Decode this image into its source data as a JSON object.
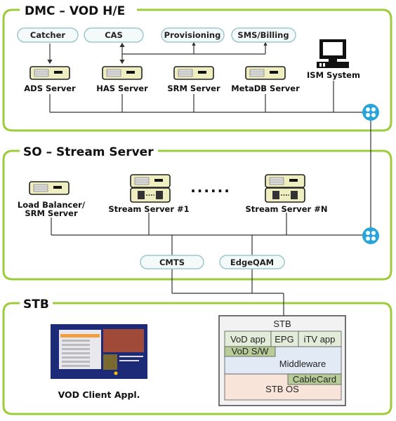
{
  "sections": {
    "dmc": {
      "title": "DMC – VOD H/E"
    },
    "so": {
      "title": "SO – Stream Server"
    },
    "stb": {
      "title": "STB"
    }
  },
  "dmc_pills": [
    "Catcher",
    "CAS",
    "Provisioning",
    "SMS/Billing"
  ],
  "dmc_servers": [
    "ADS Server",
    "HAS Server",
    "SRM Server",
    "MetaDB Server"
  ],
  "ism": "ISM System",
  "so_servers": {
    "lb_line1": "Load Balancer/",
    "lb_line2": "SRM Server",
    "ss1": "Stream Server #1",
    "ssn": "Stream Server #N",
    "dots": "......"
  },
  "so_pills": [
    "CMTS",
    "EdgeQAM"
  ],
  "client": {
    "label": "VOD Client Appl."
  },
  "stb_stack": {
    "title": "STB",
    "apps": [
      "VoD app",
      "EPG",
      "iTV app"
    ],
    "vod_sw": "VoD S/W",
    "middleware": "Middleware",
    "cablecard": "CableCard",
    "os": "STB OS"
  },
  "colors": {
    "section_border": "#9ccc3c",
    "switch": "#2aa6d6",
    "pill_border": "#9cc8cc"
  }
}
